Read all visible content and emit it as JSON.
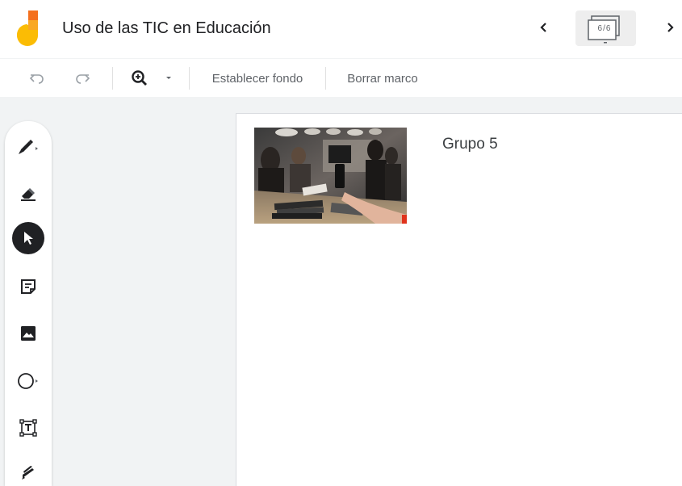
{
  "header": {
    "title": "Uso de las TIC en Educación",
    "frame_counter": "6/6"
  },
  "toolbar": {
    "set_background_label": "Establecer fondo",
    "clear_frame_label": "Borrar marco"
  },
  "canvas": {
    "text_label": "Grupo 5"
  },
  "colors": {
    "logo_orange": "#f4701e",
    "logo_yellow": "#f9c50f",
    "active_tool": "#202124",
    "icon_gray": "#5f6368"
  },
  "icons": {
    "tools": [
      "pen-icon",
      "eraser-icon",
      "select-icon",
      "sticky-note-icon",
      "image-icon",
      "circle-icon",
      "text-box-icon",
      "laser-icon"
    ]
  }
}
